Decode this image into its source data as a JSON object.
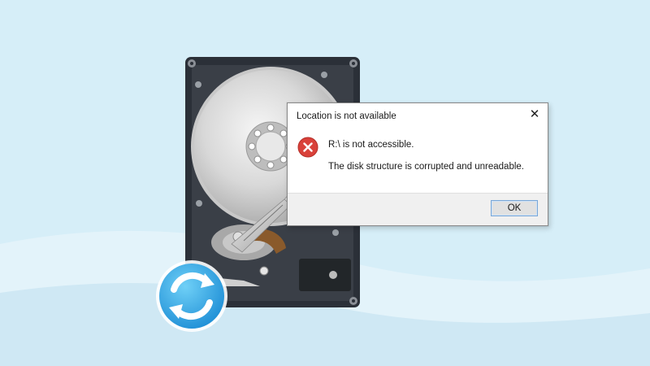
{
  "colors": {
    "background": "#d6eef8",
    "wave_light": "#e3f3fa",
    "wave_dark": "#c6e4f2",
    "error_red": "#d9413a",
    "sync_blue": "#2aa3e3"
  },
  "icons": {
    "hard_drive": "hard-drive-icon",
    "error": "error-icon",
    "close": "close-icon",
    "sync": "sync-icon"
  },
  "dialog": {
    "title": "Location is not available",
    "close_glyph": "✕",
    "message_primary": "R:\\ is not accessible.",
    "message_secondary": "The disk structure is corrupted and unreadable.",
    "ok_label": "OK"
  }
}
